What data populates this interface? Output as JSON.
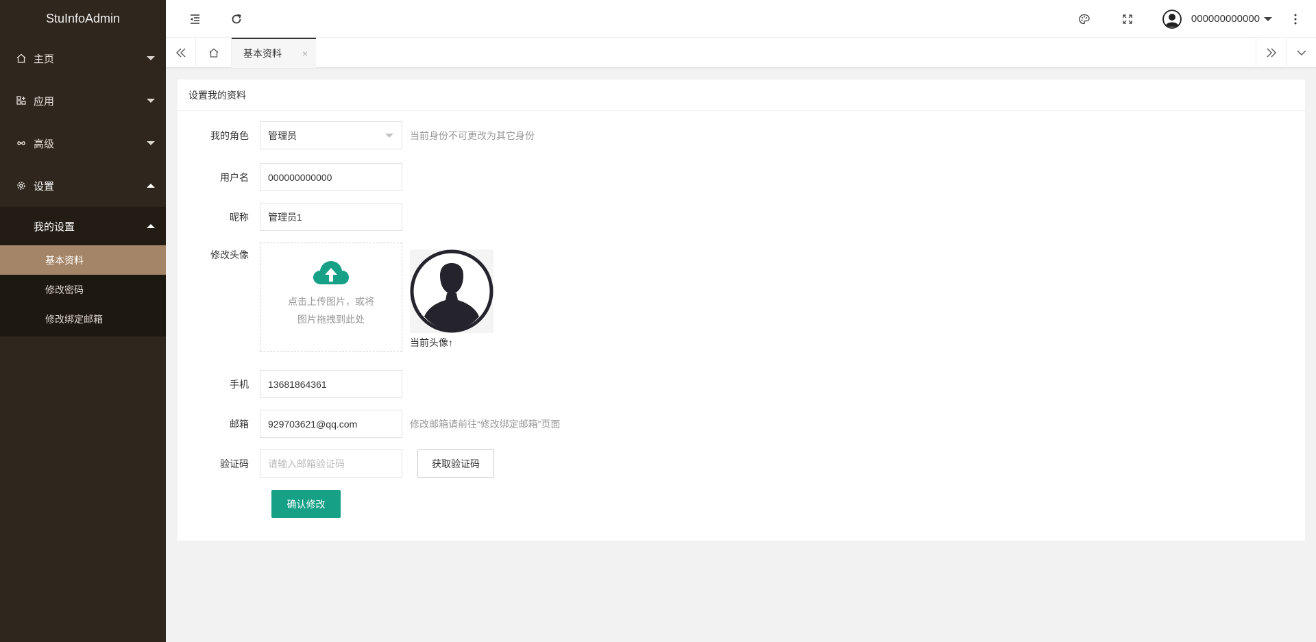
{
  "app": {
    "logo": "StuInfoAdmin"
  },
  "sidebar": {
    "items": [
      {
        "label": "主页",
        "icon": "home-icon"
      },
      {
        "label": "应用",
        "icon": "apps-icon"
      },
      {
        "label": "高级",
        "icon": "infinity-icon"
      },
      {
        "label": "设置",
        "icon": "gear-icon"
      }
    ],
    "submenu": {
      "label": "我的设置",
      "items": [
        {
          "label": "基本资料",
          "active": true
        },
        {
          "label": "修改密码",
          "active": false
        },
        {
          "label": "修改绑定邮箱",
          "active": false
        }
      ]
    }
  },
  "header": {
    "username": "000000000000"
  },
  "tabs": {
    "items": [
      {
        "label": "基本资料",
        "close": "×"
      }
    ]
  },
  "form": {
    "title": "设置我的资料",
    "role": {
      "label": "我的角色",
      "value": "管理员",
      "hint": "当前身份不可更改为其它身份"
    },
    "username": {
      "label": "用户名",
      "value": "000000000000"
    },
    "nickname": {
      "label": "昵称",
      "value": "管理员1"
    },
    "avatar": {
      "label": "修改头像",
      "upload_line1": "点击上传图片，或将",
      "upload_line2": "图片拖拽到此处",
      "caption": "当前头像↑"
    },
    "phone": {
      "label": "手机",
      "value": "13681864361"
    },
    "email": {
      "label": "邮箱",
      "value": "929703621@qq.com",
      "hint": "修改邮箱请前往“修改绑定邮箱”页面"
    },
    "code": {
      "label": "验证码",
      "placeholder": "请输入邮箱验证码",
      "button": "获取验证码"
    },
    "submit": "确认修改"
  },
  "colors": {
    "sidebar_bg": "#2f261e",
    "active_item": "#a48567",
    "primary": "#16a086"
  }
}
